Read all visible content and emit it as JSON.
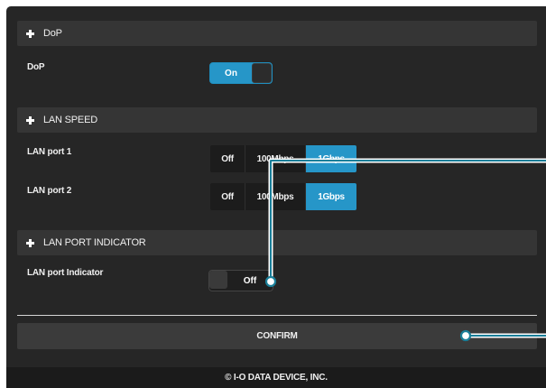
{
  "sections": {
    "dop": {
      "header": "DoP",
      "row_label": "DoP",
      "toggle_label": "On",
      "toggle_state": "on"
    },
    "lan_speed": {
      "header": "LAN SPEED",
      "port1": {
        "label": "LAN port 1",
        "options": [
          "Off",
          "100Mbps",
          "1Gbps"
        ],
        "selected": "1Gbps"
      },
      "port2": {
        "label": "LAN port 2",
        "options": [
          "Off",
          "100Mbps",
          "1Gbps"
        ],
        "selected": "1Gbps"
      }
    },
    "lan_port_indicator": {
      "header": "LAN PORT INDICATOR",
      "row_label": "LAN port Indicator",
      "toggle_label": "Off",
      "toggle_state": "off"
    }
  },
  "confirm_label": "CONFIRM",
  "footer_text": "© I-O DATA DEVICE, INC.",
  "colors": {
    "accent": "#2696c8",
    "panel_bg": "#262626",
    "header_bg": "#353535",
    "callout": "#1a7f99"
  }
}
